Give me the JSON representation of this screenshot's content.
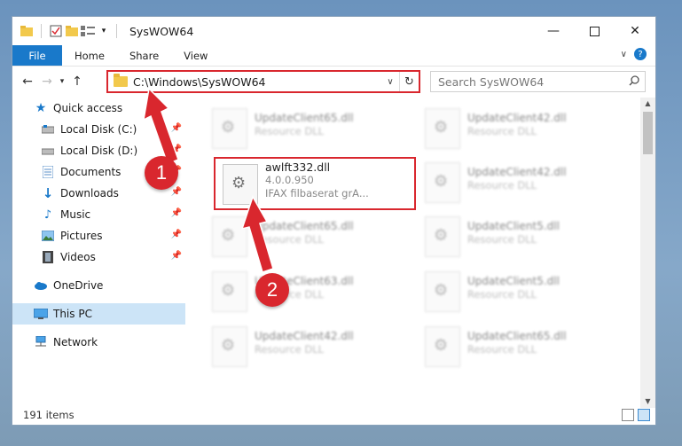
{
  "window": {
    "title": "SysWOW64"
  },
  "ribbon": {
    "file": "File",
    "tabs": [
      "Home",
      "Share",
      "View"
    ]
  },
  "address": {
    "path": "C:\\Windows\\SysWOW64"
  },
  "search": {
    "placeholder": "Search SysWOW64"
  },
  "sidebar": {
    "items": [
      {
        "label": "Quick access",
        "icon": "star-icon",
        "pinned": false
      },
      {
        "label": "Local Disk (C:)",
        "icon": "drive-icon",
        "pinned": true
      },
      {
        "label": "Local Disk (D:)",
        "icon": "drive-icon",
        "pinned": true
      },
      {
        "label": "Documents",
        "icon": "documents-icon",
        "pinned": true
      },
      {
        "label": "Downloads",
        "icon": "downloads-icon",
        "pinned": true
      },
      {
        "label": "Music",
        "icon": "music-icon",
        "pinned": true
      },
      {
        "label": "Pictures",
        "icon": "pictures-icon",
        "pinned": true
      },
      {
        "label": "Videos",
        "icon": "videos-icon",
        "pinned": true
      },
      {
        "label": "OneDrive",
        "icon": "cloud-icon",
        "pinned": false
      },
      {
        "label": "This PC",
        "icon": "pc-icon",
        "pinned": false
      },
      {
        "label": "Network",
        "icon": "network-icon",
        "pinned": false
      }
    ]
  },
  "files": [
    {
      "name": "UpdateClient65.dll",
      "sub": "Resource DLL",
      "blurred": true
    },
    {
      "name": "UpdateClient42.dll",
      "sub": "Resource DLL",
      "blurred": true
    },
    {
      "name": "awlft332.dll",
      "version": "4.0.0.950",
      "sub": "IFAX filbaserat grA...",
      "blurred": false
    },
    {
      "name": "UpdateClient42.dll",
      "sub": "Resource DLL",
      "blurred": true
    },
    {
      "name": "UpdateClient65.dll",
      "sub": "Resource DLL",
      "blurred": true
    },
    {
      "name": "UpdateClient5.dll",
      "sub": "Resource DLL",
      "blurred": true
    },
    {
      "name": "UpdateClient63.dll",
      "sub": "Resource DLL",
      "blurred": true
    },
    {
      "name": "UpdateClient5.dll",
      "sub": "Resource DLL",
      "blurred": true
    },
    {
      "name": "UpdateClient42.dll",
      "sub": "Resource DLL",
      "blurred": true
    },
    {
      "name": "UpdateClient65.dll",
      "sub": "Resource DLL",
      "blurred": true
    }
  ],
  "status": {
    "count": "191 items"
  },
  "markers": [
    "1",
    "2"
  ],
  "colors": {
    "highlight": "#d9272e",
    "accent": "#1979ca",
    "selected": "#cce4f7"
  }
}
